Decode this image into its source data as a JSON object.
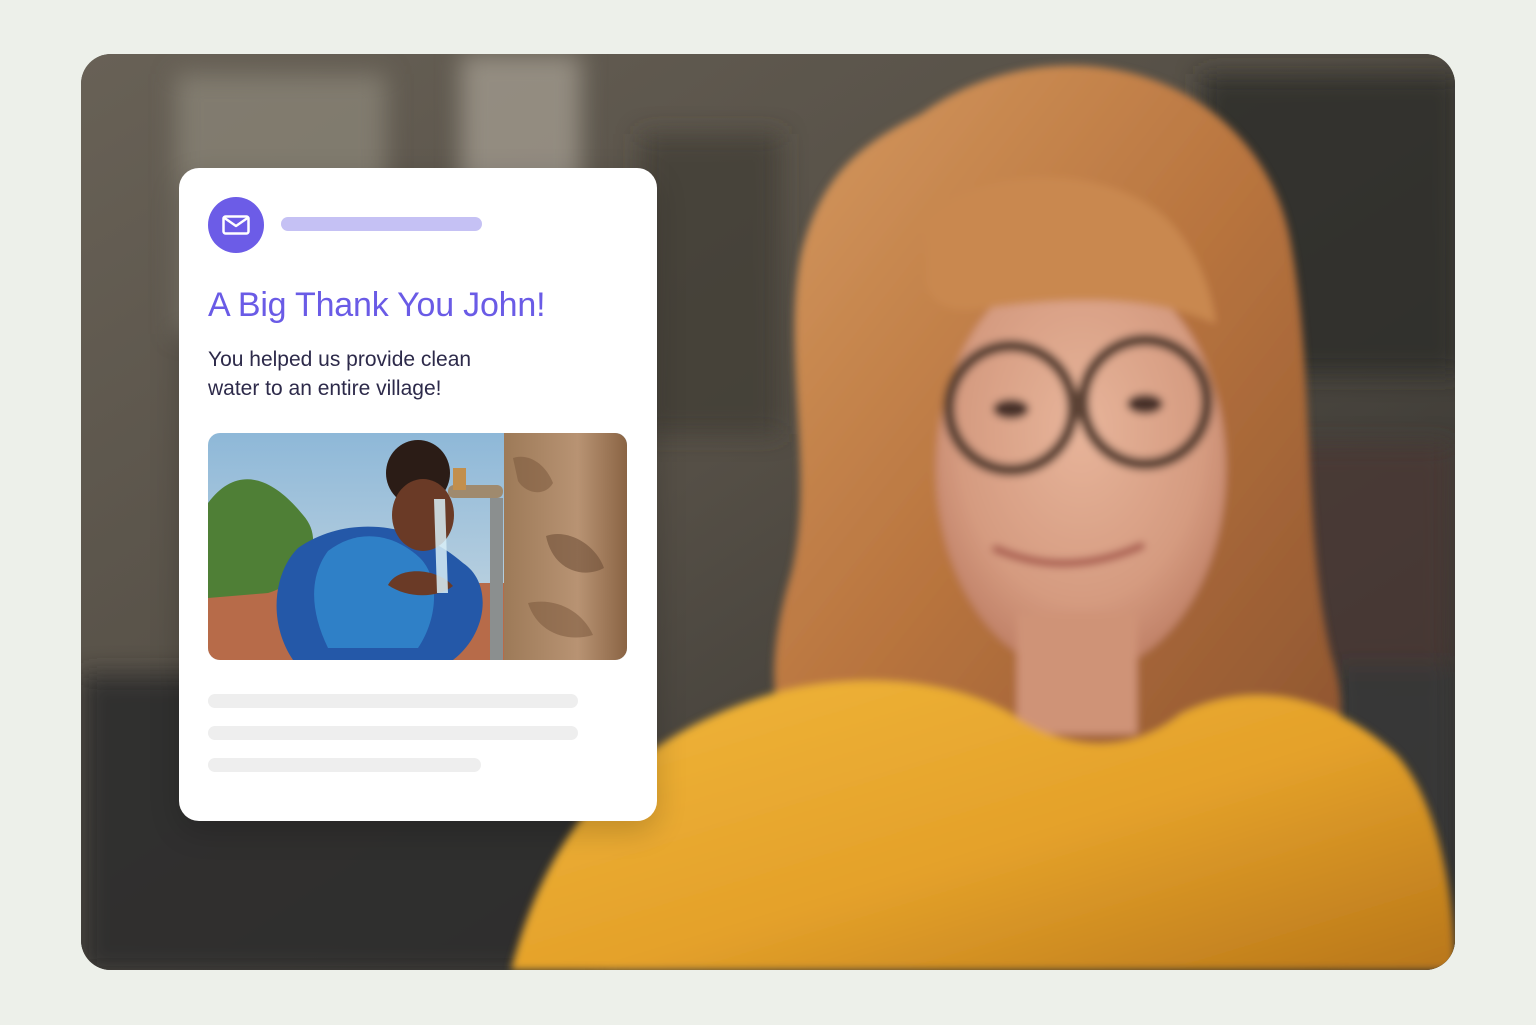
{
  "card": {
    "headline": "A Big Thank You John!",
    "message_line1": "You helped us provide clean",
    "message_line2": "water to an entire village!",
    "icon": "envelope-icon"
  },
  "colors": {
    "accent": "#6a5be6",
    "sender_placeholder": "#c5c1f4",
    "skeleton": "#eeeeee",
    "page_background": "#edf0ea"
  }
}
